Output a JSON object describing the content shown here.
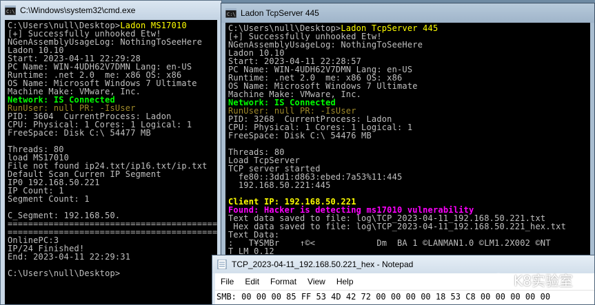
{
  "cmd1": {
    "title": "C:\\Windows\\system32\\cmd.exe",
    "lines": [
      {
        "t": "C:\\Users\\null\\Desktop>",
        "c": "c-w",
        "extra": "Ladon MS17010",
        "ec": "c-y"
      },
      {
        "t": "[+] Successfully unhooked Etw!",
        "c": "c-w"
      },
      {
        "t": "NGenAssemblyUsageLog: NothingToSeeHere",
        "c": "c-w"
      },
      {
        "t": "Ladon 10.10",
        "c": "c-w"
      },
      {
        "t": "Start: 2023-04-11 22:29:28",
        "c": "c-w"
      },
      {
        "t": "PC Name: WIN-4UDH62V7DMN Lang: en-US",
        "c": "c-w"
      },
      {
        "t": "Runtime: .net 2.0  me: x86 OS: x86",
        "c": "c-w"
      },
      {
        "t": "OS Name: Microsoft Windows 7 Ultimate",
        "c": "c-w"
      },
      {
        "t": "Machine Make: VMware, Inc.",
        "c": "c-w"
      },
      {
        "t": "Network: IS Connected",
        "c": "c-g bold"
      },
      {
        "t": "RunUser: null PR: -IsUser",
        "c": "c-o"
      },
      {
        "t": "PID: 3604  CurrentProcess: Ladon",
        "c": "c-w"
      },
      {
        "t": "CPU: Physical: 1 Cores: 1 Logical: 1",
        "c": "c-w"
      },
      {
        "t": "FreeSpace: Disk C:\\ 54477 MB",
        "c": "c-w"
      },
      {
        "t": "",
        "c": "c-w"
      },
      {
        "t": "Threads: 80",
        "c": "c-w"
      },
      {
        "t": "load MS17010",
        "c": "c-w"
      },
      {
        "t": "File not found ip24.txt/ip16.txt/ip.txt",
        "c": "c-w"
      },
      {
        "t": "Default Scan Curren IP Segment",
        "c": "c-w"
      },
      {
        "t": "IP0 192.168.50.221",
        "c": "c-w"
      },
      {
        "t": "IP Count: 1",
        "c": "c-w"
      },
      {
        "t": "Segment Count: 1",
        "c": "c-w"
      },
      {
        "t": "",
        "c": "c-w"
      },
      {
        "t": "C_Segment: 192.168.50.",
        "c": "c-w"
      },
      {
        "t": "==========================================",
        "c": "c-w"
      },
      {
        "t": "==========================================",
        "c": "c-w"
      },
      {
        "t": "OnlinePC:3",
        "c": "c-w"
      },
      {
        "t": "IP/24 Finished!",
        "c": "c-w"
      },
      {
        "t": "End: 2023-04-11 22:29:31",
        "c": "c-w"
      },
      {
        "t": "",
        "c": "c-w"
      },
      {
        "t": "C:\\Users\\null\\Desktop>",
        "c": "c-w"
      }
    ]
  },
  "cmd2": {
    "title": "Ladon TcpServer 445",
    "lines": [
      {
        "t": "C:\\Users\\null\\Desktop>",
        "c": "c-w",
        "extra": "Ladon TcpServer 445",
        "ec": "c-y"
      },
      {
        "t": "[+] Successfully unhooked Etw!",
        "c": "c-w"
      },
      {
        "t": "NGenAssemblyUsageLog: NothingToSeeHere",
        "c": "c-w"
      },
      {
        "t": "Ladon 10.10",
        "c": "c-w"
      },
      {
        "t": "Start: 2023-04-11 22:28:57",
        "c": "c-w"
      },
      {
        "t": "PC Name: WIN-4UDH62V7DMN Lang: en-US",
        "c": "c-w"
      },
      {
        "t": "Runtime: .net 2.0  me: x86 OS: x86",
        "c": "c-w"
      },
      {
        "t": "OS Name: Microsoft Windows 7 Ultimate",
        "c": "c-w"
      },
      {
        "t": "Machine Make: VMware, Inc.",
        "c": "c-w"
      },
      {
        "t": "Network: IS Connected",
        "c": "c-g bold"
      },
      {
        "t": "RunUser: null PR: -IsUser",
        "c": "c-o"
      },
      {
        "t": "PID: 3268  CurrentProcess: Ladon",
        "c": "c-w"
      },
      {
        "t": "CPU: Physical: 1 Cores: 1 Logical: 1",
        "c": "c-w"
      },
      {
        "t": "FreeSpace: Disk C:\\ 54476 MB",
        "c": "c-w"
      },
      {
        "t": "",
        "c": "c-w"
      },
      {
        "t": "Threads: 80",
        "c": "c-w"
      },
      {
        "t": "Load TcpServer",
        "c": "c-w"
      },
      {
        "t": "TCP server started",
        "c": "c-w"
      },
      {
        "t": "  fe80::3dd1:d863:ebed:7a53%11:445",
        "c": "c-w"
      },
      {
        "t": "  192.168.50.221:445",
        "c": "c-w"
      },
      {
        "t": "",
        "c": "c-w"
      },
      {
        "t": "Client IP: 192.168.50.221",
        "c": "c-y bold"
      },
      {
        "t": "Found: Hacker is detecting ms17010 vulnerability",
        "c": "c-m bold"
      },
      {
        "t": "Text data saved to file: log\\TCP_2023-04-11_192.168.50.221.txt",
        "c": "c-w"
      },
      {
        "t": " Hex data saved to file: log\\TCP_2023-04-11_192.168.50.221_hex.txt",
        "c": "c-w"
      },
      {
        "t": "Text Data:",
        "c": "c-w"
      },
      {
        "t": ":   T¥SMBr    ↑©<            Dm  BA 1 ©LANMAN1.0 ©LM1.2X002 ©NT",
        "c": "c-w"
      },
      {
        "t": "T LM 0.12",
        "c": "c-w"
      }
    ]
  },
  "notepad": {
    "title": "TCP_2023-04-11_192.168.50.221_hex - Notepad",
    "menu": [
      "File",
      "Edit",
      "Format",
      "View",
      "Help"
    ],
    "content": "SMB: 00 00 00 85 FF 53 4D 42 72 00 00 00 00 18 53 C8 00 00 00 00 00"
  },
  "watermark": {
    "text": "K8实验室"
  }
}
